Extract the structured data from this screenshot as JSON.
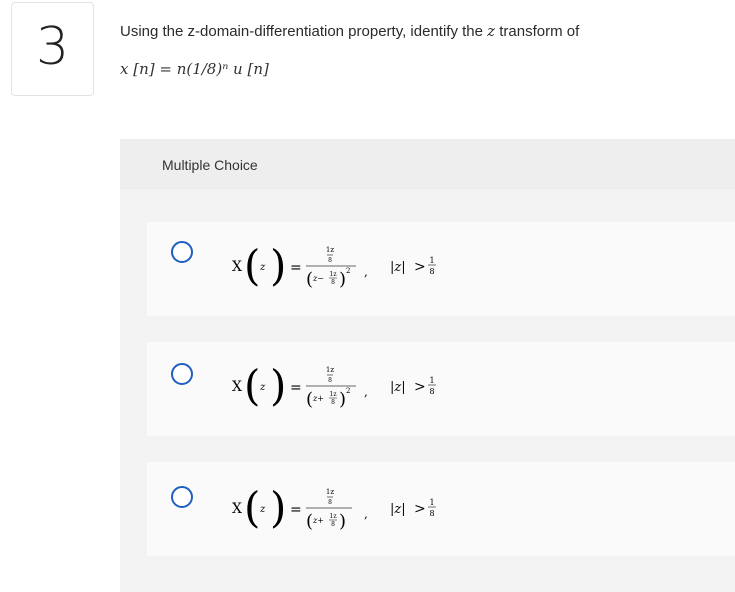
{
  "question": {
    "number": "3",
    "prompt_before": "Using the z-domain-differentiation property, identify the ",
    "prompt_var": "z",
    "prompt_after": " transform of",
    "signal": "x [n]  =  n(1/8)ⁿ u [n]"
  },
  "multiple_choice": {
    "label": "Multiple Choice",
    "options": [
      {
        "lhs": "X",
        "arg": "z",
        "num": "1z",
        "num_den": "8",
        "den_inner": "z−",
        "den_frac_num": "1z",
        "den_frac_den": "8",
        "den_power": "2",
        "roc_lhs": "|z|",
        "roc_op": ">",
        "roc_num": "1",
        "roc_den": "8"
      },
      {
        "lhs": "X",
        "arg": "z",
        "num": "1z",
        "num_den": "8",
        "den_inner": "z+",
        "den_frac_num": "1z",
        "den_frac_den": "8",
        "den_power": "2",
        "roc_lhs": "|z|",
        "roc_op": ">",
        "roc_num": "1",
        "roc_den": "8"
      },
      {
        "lhs": "X",
        "arg": "z",
        "num": "1z",
        "num_den": "8",
        "den_inner": "z+",
        "den_frac_num": "1z",
        "den_frac_den": "8",
        "den_power": "",
        "roc_lhs": "|z|",
        "roc_op": ">",
        "roc_num": "1",
        "roc_den": "8"
      }
    ]
  }
}
